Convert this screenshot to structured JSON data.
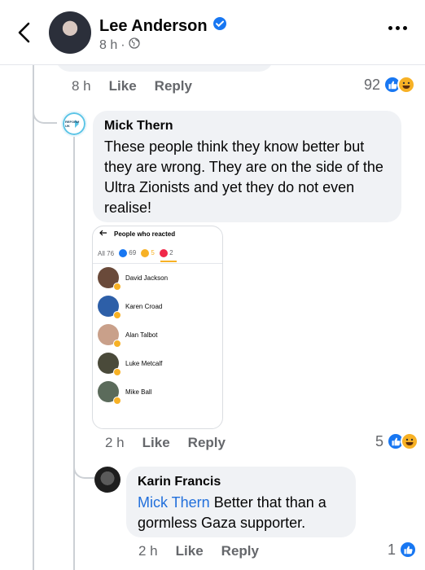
{
  "header": {
    "author_name": "Lee Anderson",
    "post_time": "8 h",
    "separator": "·"
  },
  "parent_comment": {
    "time": "8 h",
    "like_label": "Like",
    "reply_label": "Reply",
    "reaction_count": "92"
  },
  "comment_mick": {
    "name": "Mick Thern",
    "text": "These people think they know better but they are wrong. They are on the side of the Ultra Zionists and yet they do not even realise!",
    "avatar_text": "REFORM UK",
    "time": "2 h",
    "like_label": "Like",
    "reply_label": "Reply",
    "reaction_count": "5",
    "attachment": {
      "title": "People who reacted",
      "tabs": {
        "all_label": "All",
        "all_count": "76",
        "like_count": "69",
        "haha_count": "5",
        "love_count": "2"
      },
      "people": [
        "David Jackson",
        "Karen Croad",
        "Alan Talbot",
        "Luke Metcalf",
        "Mike Ball"
      ]
    }
  },
  "comment_karin": {
    "name": "Karin Francis",
    "mention": "Mick Thern",
    "text": "Better that than a gormless Gaza supporter.",
    "time": "2 h",
    "like_label": "Like",
    "reply_label": "Reply",
    "reaction_count": "1"
  },
  "colors": {
    "accent": "#1877f2",
    "mention": "#216fdb",
    "haha": "#f7b125",
    "love": "#f02849",
    "bubble": "#f0f2f5",
    "secondary_text": "#65676b"
  },
  "icons": [
    "back-chevron-icon",
    "verified-badge-icon",
    "globe-icon",
    "more-dots-icon",
    "like-icon",
    "haha-icon",
    "love-icon"
  ]
}
